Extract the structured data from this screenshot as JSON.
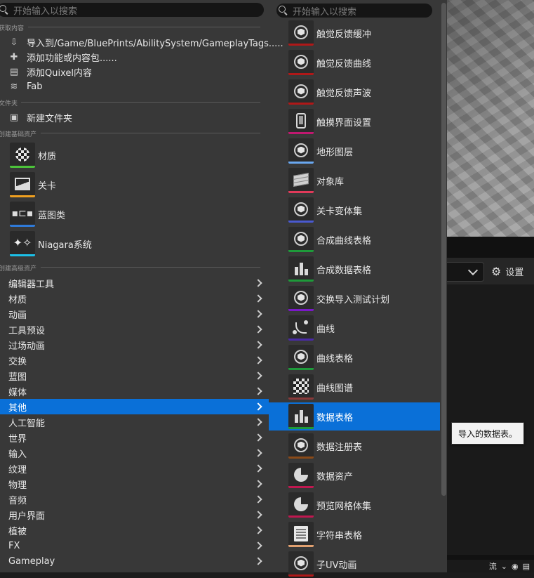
{
  "left_menu": {
    "search_placeholder": "开始输入以搜索",
    "sections": {
      "get_content": "获取内容",
      "folder": "文件夹",
      "basic_assets": "创建基础资产",
      "advanced_assets": "创建高级资产"
    },
    "get_content_items": [
      {
        "label": "导入到/Game/BluePrints/AbilitySystem/GameplayTags.....",
        "icon": "import-icon"
      },
      {
        "label": "添加功能或内容包......",
        "icon": "add-feature-icon"
      },
      {
        "label": "添加Quixel内容",
        "icon": "quixel-icon"
      },
      {
        "label": "Fab",
        "icon": "fab-icon"
      }
    ],
    "folder_items": [
      {
        "label": "新建文件夹",
        "icon": "new-folder-icon"
      }
    ],
    "basic_assets": [
      {
        "label": "材质",
        "icon": "material-icon",
        "color": "#4cc23a"
      },
      {
        "label": "关卡",
        "icon": "level-icon",
        "color": "#f0a020"
      },
      {
        "label": "蓝图类",
        "icon": "blueprint-icon",
        "color": "#2f7ad8"
      },
      {
        "label": "Niagara系统",
        "icon": "niagara-icon",
        "color": "#1cc0e8"
      }
    ],
    "categories": [
      "编辑器工具",
      "材质",
      "动画",
      "工具预设",
      "过场动画",
      "交换",
      "蓝图",
      "媒体",
      "其他",
      "人工智能",
      "世界",
      "输入",
      "纹理",
      "物理",
      "音频",
      "用户界面",
      "植被",
      "FX",
      "Gameplay"
    ],
    "selected_category": "其他"
  },
  "sub_menu": {
    "search_placeholder": "开始输入以搜索",
    "items": [
      {
        "label": "触觉反馈缓冲",
        "icon": "sphere-icon",
        "color": "#b01818"
      },
      {
        "label": "触觉反馈曲线",
        "icon": "sphere-icon",
        "color": "#b01818"
      },
      {
        "label": "触觉反馈声波",
        "icon": "sphere-icon",
        "color": "#b01818"
      },
      {
        "label": "触摸界面设置",
        "icon": "tablet-icon",
        "color": "#c01870"
      },
      {
        "label": "地形图层",
        "icon": "sphere-icon",
        "color": "#6aa8f0"
      },
      {
        "label": "对象库",
        "icon": "stack-icon",
        "color": "#e03a5a"
      },
      {
        "label": "关卡变体集",
        "icon": "sphere-icon",
        "color": "#4a5ad0"
      },
      {
        "label": "合成曲线表格",
        "icon": "sphere-icon",
        "color": "#1e9a3a"
      },
      {
        "label": "合成数据表格",
        "icon": "bars-icon",
        "color": "#1e9a3a"
      },
      {
        "label": "交换导入测试计划",
        "icon": "sphere-icon",
        "color": "#7a18c8"
      },
      {
        "label": "曲线",
        "icon": "curve-icon",
        "color": "#4a2aa8"
      },
      {
        "label": "曲线表格",
        "icon": "sphere-icon",
        "color": "#1e9a3a"
      },
      {
        "label": "曲线图谱",
        "icon": "checker-icon",
        "color": "#8a3a3a"
      },
      {
        "label": "数据表格",
        "icon": "bars-icon",
        "color": "#1e9a3a"
      },
      {
        "label": "数据注册表",
        "icon": "ring-icon",
        "color": "#8a4a18"
      },
      {
        "label": "数据资产",
        "icon": "pie-icon",
        "color": "#c01850"
      },
      {
        "label": "预览网格体集",
        "icon": "pie-icon",
        "color": "#c01850"
      },
      {
        "label": "字符串表格",
        "icon": "sheet-icon",
        "color": "#e0a070"
      },
      {
        "label": "子UV动画",
        "icon": "sphere-icon",
        "color": "#b01818"
      }
    ],
    "selected_item": "数据表格"
  },
  "tooltip": {
    "text": "导入的数据表。"
  },
  "background": {
    "settings_label": "设置",
    "bottombar_label": "流"
  },
  "colors": {
    "selection": "#0a70d8",
    "menu_bg": "#383838"
  }
}
